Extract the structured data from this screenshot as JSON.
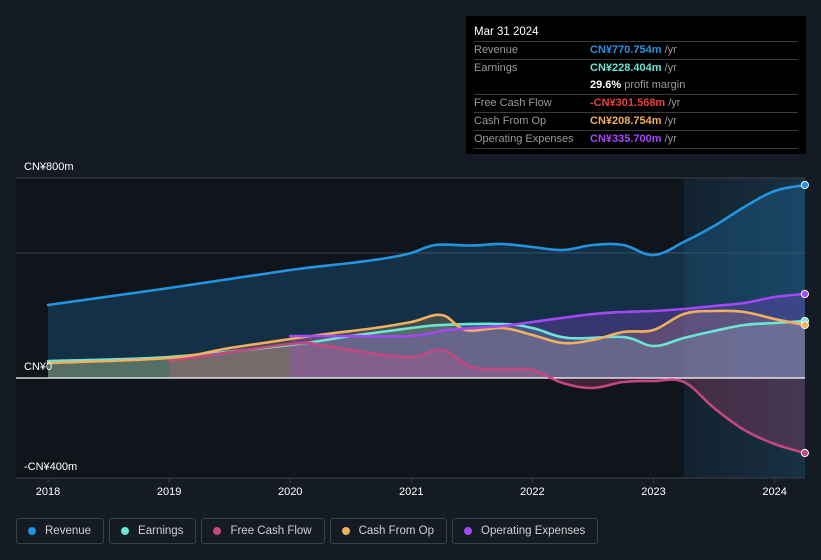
{
  "tooltip": {
    "date": "Mar 31 2024",
    "rows": [
      {
        "label": "Revenue",
        "value": "CN¥770.754m",
        "unit": "/yr",
        "color": "#2394df"
      },
      {
        "label": "Earnings",
        "value": "CN¥228.404m",
        "unit": "/yr",
        "color": "#6ce5d4"
      },
      {
        "label": "",
        "value": "29.6%",
        "unit": "profit margin",
        "color": "#ffffff"
      },
      {
        "label": "Free Cash Flow",
        "value": "-CN¥301.568m",
        "unit": "/yr",
        "color": "#e8403f"
      },
      {
        "label": "Cash From Op",
        "value": "CN¥208.754m",
        "unit": "/yr",
        "color": "#f0b060"
      },
      {
        "label": "Operating Expenses",
        "value": "CN¥335.700m",
        "unit": "/yr",
        "color": "#a447f5"
      }
    ]
  },
  "legend": [
    {
      "label": "Revenue",
      "color": "#2394df"
    },
    {
      "label": "Earnings",
      "color": "#6ce5d4"
    },
    {
      "label": "Free Cash Flow",
      "color": "#c2487f"
    },
    {
      "label": "Cash From Op",
      "color": "#f0b060"
    },
    {
      "label": "Operating Expenses",
      "color": "#a447f5"
    }
  ],
  "chart_data": {
    "type": "area",
    "title": "",
    "xlabel": "",
    "ylabel": "",
    "currency": "CN¥",
    "units": "m",
    "xlim": [
      2017.75,
      2024.25
    ],
    "ylim": [
      -400,
      800
    ],
    "y_ticks": [
      {
        "value": 800,
        "label": "CN¥800m"
      },
      {
        "value": 0,
        "label": "CN¥0"
      },
      {
        "value": -400,
        "label": "-CN¥400m"
      }
    ],
    "gridlines": [
      800,
      500
    ],
    "x_ticks": [
      {
        "value": 2018,
        "label": "2018"
      },
      {
        "value": 2019,
        "label": "2019"
      },
      {
        "value": 2020,
        "label": "2020"
      },
      {
        "value": 2021,
        "label": "2021"
      },
      {
        "value": 2022,
        "label": "2022"
      },
      {
        "value": 2023,
        "label": "2023"
      },
      {
        "value": 2024,
        "label": "2024"
      }
    ],
    "highlight_from": 2023.25,
    "series": [
      {
        "name": "Revenue",
        "color": "#2394df",
        "x": [
          2018,
          2019,
          2020,
          2020.5,
          2020.8,
          2021,
          2021.2,
          2021.5,
          2021.75,
          2022,
          2022.25,
          2022.5,
          2022.75,
          2023,
          2023.25,
          2023.5,
          2023.75,
          2024,
          2024.25
        ],
        "y": [
          292,
          360,
          432,
          460,
          480,
          500,
          532,
          530,
          536,
          524,
          512,
          532,
          532,
          492,
          544,
          608,
          684,
          748,
          772
        ]
      },
      {
        "name": "Earnings",
        "color": "#6ce5d4",
        "x": [
          2018,
          2019,
          2020,
          2020.5,
          2021,
          2021.25,
          2021.75,
          2022,
          2022.3,
          2022.75,
          2023,
          2023.25,
          2023.5,
          2023.75,
          2024,
          2024.25
        ],
        "y": [
          68,
          84,
          132,
          168,
          200,
          212,
          216,
          200,
          160,
          164,
          128,
          160,
          188,
          212,
          220,
          228
        ]
      },
      {
        "name": "Free Cash Flow",
        "color": "#c2487f",
        "x": [
          2019,
          2020,
          2020.25,
          2020.6,
          2021,
          2021.25,
          2021.5,
          2021.75,
          2022,
          2022.25,
          2022.5,
          2022.75,
          2023,
          2023.25,
          2023.5,
          2023.75,
          2024,
          2024.25
        ],
        "y": [
          68,
          136,
          132,
          104,
          84,
          112,
          44,
          36,
          32,
          -20,
          -40,
          -16,
          -12,
          -16,
          -120,
          -208,
          -264,
          -300
        ]
      },
      {
        "name": "Cash From Op",
        "color": "#f0b060",
        "x": [
          2018,
          2019,
          2019.5,
          2020,
          2020.3,
          2020.7,
          2021,
          2021.25,
          2021.45,
          2021.75,
          2022,
          2022.25,
          2022.5,
          2022.75,
          2023,
          2023.25,
          2023.5,
          2023.75,
          2024,
          2024.25
        ],
        "y": [
          60,
          80,
          120,
          156,
          176,
          200,
          224,
          252,
          192,
          200,
          172,
          140,
          152,
          184,
          192,
          256,
          268,
          264,
          236,
          212
        ]
      },
      {
        "name": "Operating Expenses",
        "color": "#a447f5",
        "x": [
          2020,
          2020.5,
          2021,
          2021.3,
          2021.75,
          2022,
          2022.5,
          2022.75,
          2023,
          2023.25,
          2023.5,
          2023.75,
          2024,
          2024.25
        ],
        "y": [
          168,
          168,
          168,
          192,
          208,
          224,
          256,
          264,
          268,
          276,
          288,
          300,
          324,
          336
        ]
      }
    ]
  }
}
